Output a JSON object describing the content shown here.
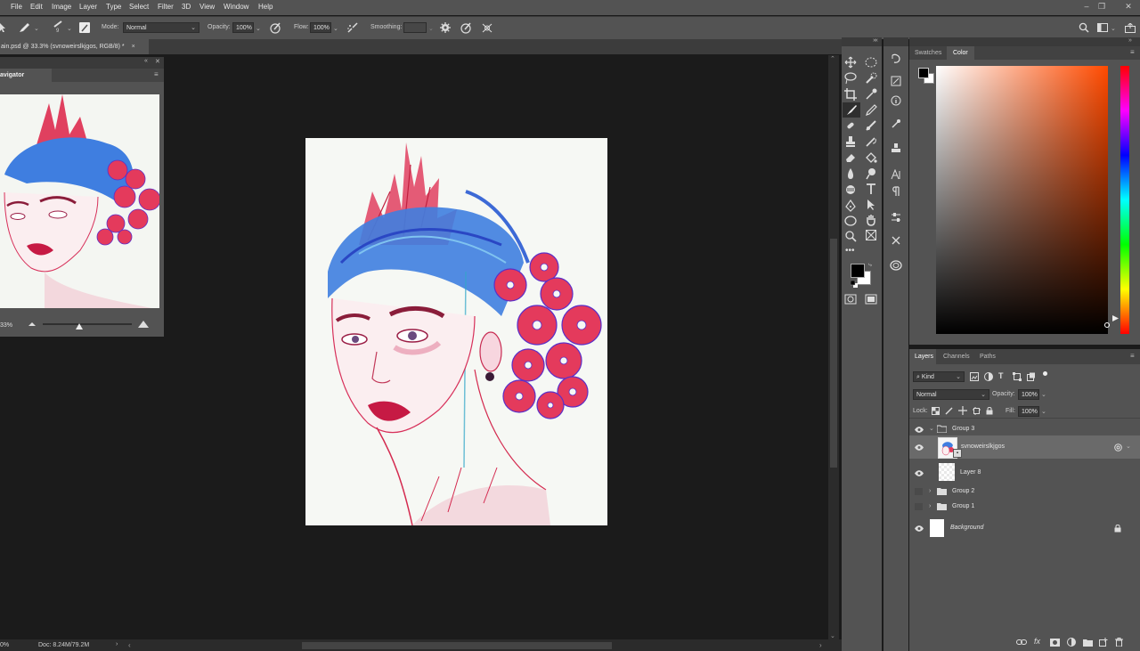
{
  "menu": [
    "File",
    "Edit",
    "Image",
    "Layer",
    "Type",
    "Select",
    "Filter",
    "3D",
    "View",
    "Window",
    "Help"
  ],
  "options": {
    "brush_size": "9",
    "mode_label": "Mode:",
    "mode_value": "Normal",
    "opacity_label": "Opacity:",
    "opacity_value": "100%",
    "flow_label": "Flow:",
    "flow_value": "100%",
    "smoothing_label": "Smoothing:",
    "smoothing_value": ""
  },
  "document": {
    "tab_title": "ain.psd @ 33.3% (svnoweirslkjgos, RGB/8) *",
    "close_glyph": "×"
  },
  "navigator": {
    "title": "avigator",
    "zoom": "33%"
  },
  "status": {
    "zoom": "0%",
    "doc": "Doc: 8.24M/79.2M"
  },
  "color_panel": {
    "tabs": [
      "Swatches",
      "Color"
    ],
    "active_tab": "Color"
  },
  "layers_panel": {
    "tabs": [
      "Layers",
      "Channels",
      "Paths"
    ],
    "active_tab": "Layers",
    "filter_kind": "Kind",
    "blend_mode": "Normal",
    "opacity_label": "Opacity:",
    "opacity_value": "100%",
    "lock_label": "Lock:",
    "fill_label": "Fill:",
    "fill_value": "100%",
    "layers": [
      {
        "name": "Group 3",
        "type": "group",
        "visible": true,
        "expanded": true
      },
      {
        "name": "svnoweirslkjgos",
        "type": "image",
        "visible": true,
        "selected": true
      },
      {
        "name": "Layer 8",
        "type": "pixel",
        "visible": true
      },
      {
        "name": "Group 2",
        "type": "group",
        "visible": false
      },
      {
        "name": "Group 1",
        "type": "group",
        "visible": false
      },
      {
        "name": "Background",
        "type": "background",
        "visible": true,
        "locked": true
      }
    ]
  },
  "colors": {
    "chrome": "#535353",
    "canvas_bg": "#1b1b1b",
    "selected_layer": "#6a6a6a",
    "hue_pick": "#ff4a00"
  }
}
